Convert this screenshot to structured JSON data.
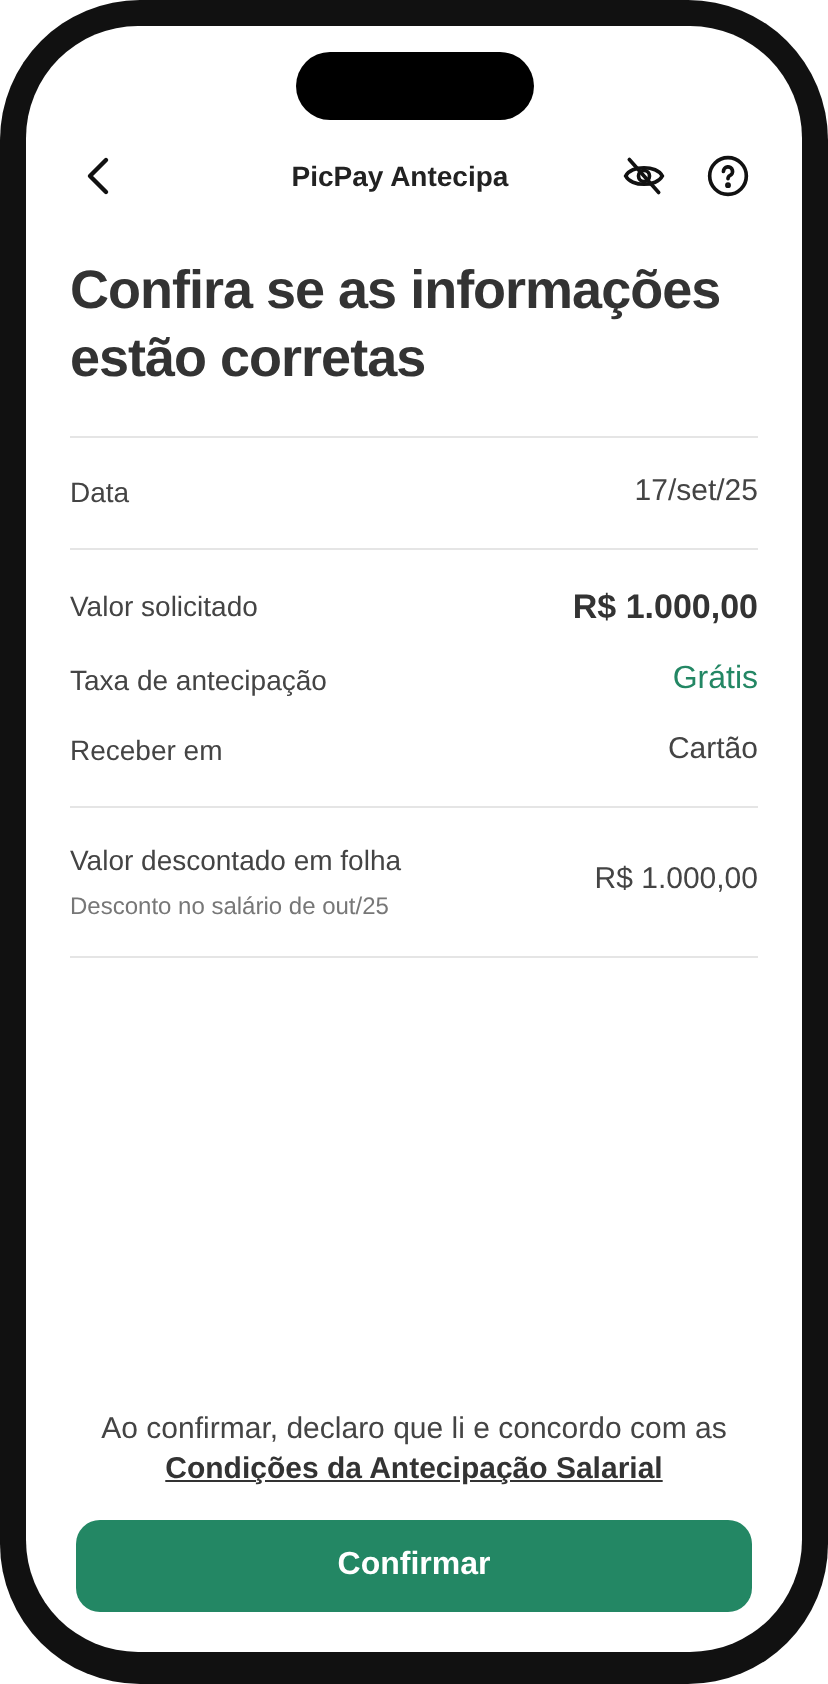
{
  "header": {
    "title": "PicPay Antecipa"
  },
  "title": "Confira se as informações estão corretas",
  "sections": [
    {
      "rows": [
        {
          "label": "Data",
          "value": "17/set/25",
          "kind": "normal"
        }
      ]
    },
    {
      "rows": [
        {
          "label": "Valor solicitado",
          "value": "R$ 1.000,00",
          "kind": "bold"
        },
        {
          "label": "Taxa de antecipação",
          "value": "Grátis",
          "kind": "positive"
        },
        {
          "label": "Receber em",
          "value": "Cartão",
          "kind": "normal"
        }
      ]
    },
    {
      "rows": [
        {
          "label": "Valor descontado em folha",
          "sublabel": "Desconto no salário de out/25",
          "value": "R$ 1.000,00",
          "kind": "normal"
        }
      ]
    }
  ],
  "notice": {
    "text": "Ao confirmar, declaro que li e concordo com as",
    "link": "Condições da Antecipação Salarial"
  },
  "button": "Confirmar"
}
